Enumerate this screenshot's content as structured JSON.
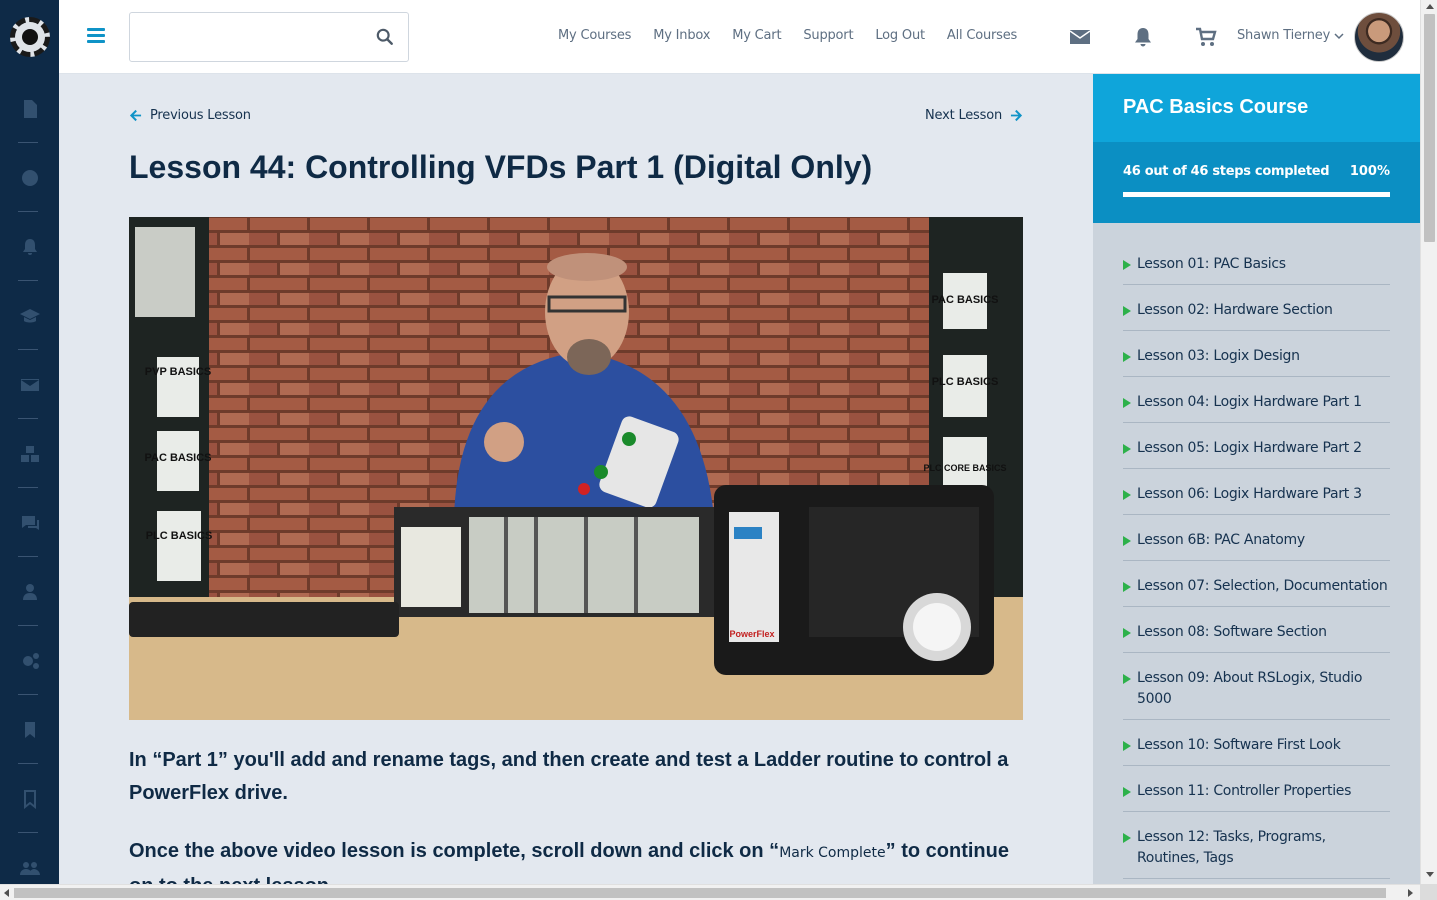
{
  "header": {
    "search_placeholder": "",
    "nav": [
      "My Courses",
      "My Inbox",
      "My Cart",
      "Support",
      "Log Out",
      "All Courses"
    ],
    "user_name": "Shawn Tierney"
  },
  "main": {
    "prev_label": "Previous Lesson",
    "next_label": "Next Lesson",
    "title": "Lesson 44: Controlling VFDs Part 1 (Digital Only)",
    "para1": "In “Part 1” you'll add and rename tags, and then create and test a Ladder routine to control a PowerFlex drive.",
    "para2_a": "Once the above video lesson is complete, scroll down and click on “",
    "para2_mark": "Mark Complete",
    "para2_b": "” to continue on to the next lesson."
  },
  "video": {
    "book_labels": [
      "PVP BASICS",
      "PAC BASICS",
      "PLC BASICS",
      "PAC BASICS",
      "PLC BASICS",
      "PLC CORE BASICS"
    ],
    "drive_label": "PowerFlex"
  },
  "sidebar": {
    "course_title": "PAC Basics Course",
    "progress_text": "46 out of 46 steps completed",
    "progress_pct": "100%",
    "progress_value": 1.0,
    "lessons": [
      "Lesson 01: PAC Basics",
      "Lesson 02: Hardware Section",
      "Lesson 03: Logix Design",
      "Lesson 04: Logix Hardware Part 1",
      "Lesson 05: Logix Hardware Part 2",
      "Lesson 06: Logix Hardware Part 3",
      "Lesson 6B: PAC Anatomy",
      "Lesson 07: Selection, Documentation",
      "Lesson 08: Software Section",
      "Lesson 09: About RSLogix, Studio 5000",
      "Lesson 10: Software First Look",
      "Lesson 11: Controller Properties",
      "Lesson 12: Tasks, Programs, Routines, Tags"
    ]
  },
  "rail_icons": [
    "document-icon",
    "globe-icon",
    "bell-icon",
    "graduation-cap-icon",
    "envelope-icon",
    "cubes-icon",
    "comments-icon",
    "user-icon",
    "settings-icon",
    "bookmark-icon",
    "bookmark-outline-icon",
    "users-icon"
  ],
  "colors": {
    "accent": "#0fa5da",
    "rail": "#0e2a47",
    "check": "#2db14a"
  }
}
